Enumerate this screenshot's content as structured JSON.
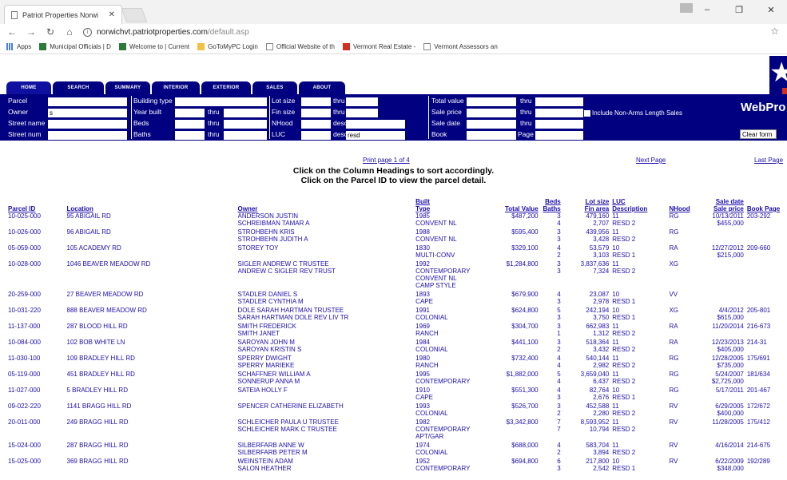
{
  "browser": {
    "tab_title": "Patriot Properties Norwi",
    "url_host": "norwichvt.patriotproperties.com",
    "url_path": "/default.asp",
    "bookmarks": [
      "Apps",
      "Municipal Officials | D",
      "Welcome to | Current",
      "GoToMyPC Login",
      "Official Website of th",
      "Vermont Real Estate -",
      "Vermont Assessors an"
    ]
  },
  "nav_tabs": [
    "HOME",
    "SEARCH",
    "SUMMARY",
    "INTERIOR",
    "EXTERIOR",
    "SALES",
    "ABOUT"
  ],
  "brand": "WebPro",
  "search": {
    "parcel": "Parcel",
    "owner": "Owner",
    "owner_value": "s",
    "street_name": "Street name",
    "street_num": "Street num",
    "building_type": "Building type",
    "year_built": "Year built",
    "beds": "Beds",
    "baths": "Baths",
    "thru": "thru",
    "lot_size": "Lot size",
    "fin_size": "Fin size",
    "nhood": "NHood",
    "luc": "LUC",
    "desc": "desc",
    "luc_desc_value": "resd",
    "total_value": "Total value",
    "sale_price": "Sale price",
    "sale_date": "Sale date",
    "book": "Book",
    "page": "Page",
    "non_arms": "Include Non-Arms Length Sales",
    "clear": "Clear form"
  },
  "pager": {
    "print": "Print page 1 of 4",
    "next": "Next Page",
    "last": "Last Page"
  },
  "instructions": {
    "line1": "Click on the Column Headings to sort accordingly.",
    "line2": "Click on the Parcel ID to view the parcel detail."
  },
  "columns": {
    "parcel_id": "Parcel ID",
    "location": "Location",
    "owner": "Owner",
    "built": "Built",
    "type": "Type",
    "total_value": "Total Value",
    "beds": "Beds",
    "baths": "Baths",
    "lot_size": "Lot size",
    "fin_area": "Fin area",
    "luc": "LUC",
    "description": "Description",
    "nhood": "NHood",
    "sale_date": "Sale date",
    "sale_price": "Sale price",
    "book_page": "Book Page"
  },
  "rows": [
    {
      "id": "10-025-000",
      "loc": "95  ABIGAIL RD",
      "owner": [
        "ANDERSON JUSTIN",
        "SCHREIBMAN TAMAR A"
      ],
      "built": "1985",
      "type": [
        "CONVENT NL"
      ],
      "value": "$487,200",
      "bb": [
        "3",
        "4"
      ],
      "lot": [
        "479,160",
        "2,707"
      ],
      "luc": [
        "11",
        "RESD 2"
      ],
      "nh": "RG",
      "sale": [
        "10/13/2011",
        "$455,000"
      ],
      "book": "203-292"
    },
    {
      "id": "10-026-000",
      "loc": "96  ABIGAIL RD",
      "owner": [
        "STROHBEHN KRIS",
        "STROHBEHN JUDITH A"
      ],
      "built": "1988",
      "type": [
        "CONVENT NL"
      ],
      "value": "$595,400",
      "bb": [
        "3",
        "3"
      ],
      "lot": [
        "439,956",
        "3,428"
      ],
      "luc": [
        "11",
        "RESD 2"
      ],
      "nh": "RG",
      "sale": [
        "",
        ""
      ],
      "book": ""
    },
    {
      "id": "05-059-000",
      "loc": "105  ACADEMY RD",
      "owner": [
        "STOREY TOY"
      ],
      "built": "1830",
      "type": [
        "MULTI-CONV"
      ],
      "value": "$329,100",
      "bb": [
        "4",
        "2"
      ],
      "lot": [
        "53,579",
        "3,103"
      ],
      "luc": [
        "10",
        "RESD 1"
      ],
      "nh": "RA",
      "sale": [
        "12/27/2012",
        "$215,000"
      ],
      "book": "209-660"
    },
    {
      "id": "10-028-000",
      "loc": "1046  BEAVER MEADOW RD",
      "owner": [
        "SIGLER ANDREW C TRUSTEE",
        "ANDREW C SIGLER REV TRUST"
      ],
      "built": "1992",
      "type": [
        "CONTEMPORARY",
        "CONVENT NL",
        "CAMP STYLE"
      ],
      "value": "$1,284,800",
      "bb": [
        "3",
        "3"
      ],
      "lot": [
        "3,837,636",
        "7,324"
      ],
      "luc": [
        "11",
        "RESD 2"
      ],
      "nh": "XG",
      "sale": [
        "",
        ""
      ],
      "book": ""
    },
    {
      "id": "20-259-000",
      "loc": "27  BEAVER MEADOW RD",
      "owner": [
        "STADLER DANIEL S",
        "STADLER CYNTHIA M"
      ],
      "built": "1893",
      "type": [
        "CAPE"
      ],
      "value": "$679,900",
      "bb": [
        "4",
        "3"
      ],
      "lot": [
        "23,087",
        "2,978"
      ],
      "luc": [
        "10",
        "RESD 1"
      ],
      "nh": "VV",
      "sale": [
        "",
        ""
      ],
      "book": ""
    },
    {
      "id": "10-031-220",
      "loc": "888  BEAVER MEADOW RD",
      "owner": [
        "DOLE SARAH HARTMAN TRUSTEE",
        "SARAH HARTMAN DOLE REV LIV TR"
      ],
      "built": "1991",
      "type": [
        "COLONIAL"
      ],
      "value": "$624,800",
      "bb": [
        "5",
        "3"
      ],
      "lot": [
        "242,194",
        "3,750"
      ],
      "luc": [
        "10",
        "RESD 1"
      ],
      "nh": "XG",
      "sale": [
        "4/4/2012",
        "$615,000"
      ],
      "book": "205-801"
    },
    {
      "id": "11-137-000",
      "loc": "287  BLOOD HILL RD",
      "owner": [
        "SMITH FREDERICK",
        "SMITH JANET"
      ],
      "built": "1969",
      "type": [
        "RANCH"
      ],
      "value": "$304,700",
      "bb": [
        "3",
        "1"
      ],
      "lot": [
        "662,983",
        "1,312"
      ],
      "luc": [
        "11",
        "RESD 2"
      ],
      "nh": "RA",
      "sale": [
        "11/20/2014",
        ""
      ],
      "book": "216-673"
    },
    {
      "id": "10-084-000",
      "loc": "102  BOB WHITE LN",
      "owner": [
        "SAROYAN JOHN M",
        "SAROYAN KRISTIN S"
      ],
      "built": "1984",
      "type": [
        "COLONIAL"
      ],
      "value": "$441,100",
      "bb": [
        "3",
        "2"
      ],
      "lot": [
        "518,364",
        "3,432"
      ],
      "luc": [
        "11",
        "RESD 2"
      ],
      "nh": "RA",
      "sale": [
        "12/23/2013",
        "$405,000"
      ],
      "book": "214-31"
    },
    {
      "id": "11-030-100",
      "loc": "109  BRADLEY HILL RD",
      "owner": [
        "SPERRY DWIGHT",
        "SPERRY MARIEKE"
      ],
      "built": "1980",
      "type": [
        "RANCH"
      ],
      "value": "$732,400",
      "bb": [
        "4",
        "4"
      ],
      "lot": [
        "540,144",
        "2,982"
      ],
      "luc": [
        "11",
        "RESD 2"
      ],
      "nh": "RG",
      "sale": [
        "12/28/2005",
        "$735,000"
      ],
      "book": "175/691"
    },
    {
      "id": "05-119-000",
      "loc": "451  BRADLEY HILL RD",
      "owner": [
        "SCHAFFNER WILLIAM A",
        "SONNERUP ANNA M"
      ],
      "built": "1995",
      "type": [
        "CONTEMPORARY"
      ],
      "value": "$1,882,000",
      "bb": [
        "5",
        "4"
      ],
      "lot": [
        "3,659,040",
        "6,437"
      ],
      "luc": [
        "11",
        "RESD 2"
      ],
      "nh": "RG",
      "sale": [
        "5/24/2007",
        "$2,725,000"
      ],
      "book": "181/634"
    },
    {
      "id": "11-027-000",
      "loc": "5  BRADLEY HILL RD",
      "owner": [
        "SATEIA HOLLY F"
      ],
      "built": "1910",
      "type": [
        "CAPE"
      ],
      "value": "$551,300",
      "bb": [
        "4",
        "3"
      ],
      "lot": [
        "82,764",
        "2,676"
      ],
      "luc": [
        "10",
        "RESD 1"
      ],
      "nh": "RG",
      "sale": [
        "5/17/2011",
        ""
      ],
      "book": "201-467"
    },
    {
      "id": "09-022-220",
      "loc": "1141  BRAGG HILL RD",
      "owner": [
        "SPENCER CATHERINE ELIZABETH"
      ],
      "built": "1993",
      "type": [
        "COLONIAL"
      ],
      "value": "$526,700",
      "bb": [
        "3",
        "2"
      ],
      "lot": [
        "452,588",
        "2,280"
      ],
      "luc": [
        "11",
        "RESD 2"
      ],
      "nh": "RV",
      "sale": [
        "6/29/2005",
        "$400,000"
      ],
      "book": "172/672"
    },
    {
      "id": "20-011-000",
      "loc": "249  BRAGG HILL RD",
      "owner": [
        "SCHLEICHER PAULA U TRUSTEE",
        "SCHLEICHER MARK C TRUSTEE"
      ],
      "built": "1982",
      "type": [
        "CONTEMPORARY",
        "APT/GAR"
      ],
      "value": "$3,342,800",
      "bb": [
        "7",
        "7"
      ],
      "lot": [
        "8,593,952",
        "10,794"
      ],
      "luc": [
        "11",
        "RESD 2"
      ],
      "nh": "RV",
      "sale": [
        "11/28/2005",
        ""
      ],
      "book": "175/412"
    },
    {
      "id": "15-024-000",
      "loc": "287  BRAGG HILL RD",
      "owner": [
        "SILBERFARB ANNE W",
        "SILBERFARB PETER M"
      ],
      "built": "1974",
      "type": [
        "COLONIAL"
      ],
      "value": "$688,000",
      "bb": [
        "4",
        "2"
      ],
      "lot": [
        "583,704",
        "3,894"
      ],
      "luc": [
        "11",
        "RESD 2"
      ],
      "nh": "RV",
      "sale": [
        "4/16/2014",
        ""
      ],
      "book": "214-675"
    },
    {
      "id": "15-025-000",
      "loc": "369  BRAGG HILL RD",
      "owner": [
        "WEINSTEIN ADAM",
        "SALON HEATHER"
      ],
      "built": "1952",
      "type": [
        "CONTEMPORARY"
      ],
      "value": "$694,800",
      "bb": [
        "6",
        "3"
      ],
      "lot": [
        "217,800",
        "2,542"
      ],
      "luc": [
        "10",
        "RESD 1"
      ],
      "nh": "RV",
      "sale": [
        "6/22/2009",
        "$348,000"
      ],
      "book": "192/289"
    }
  ]
}
